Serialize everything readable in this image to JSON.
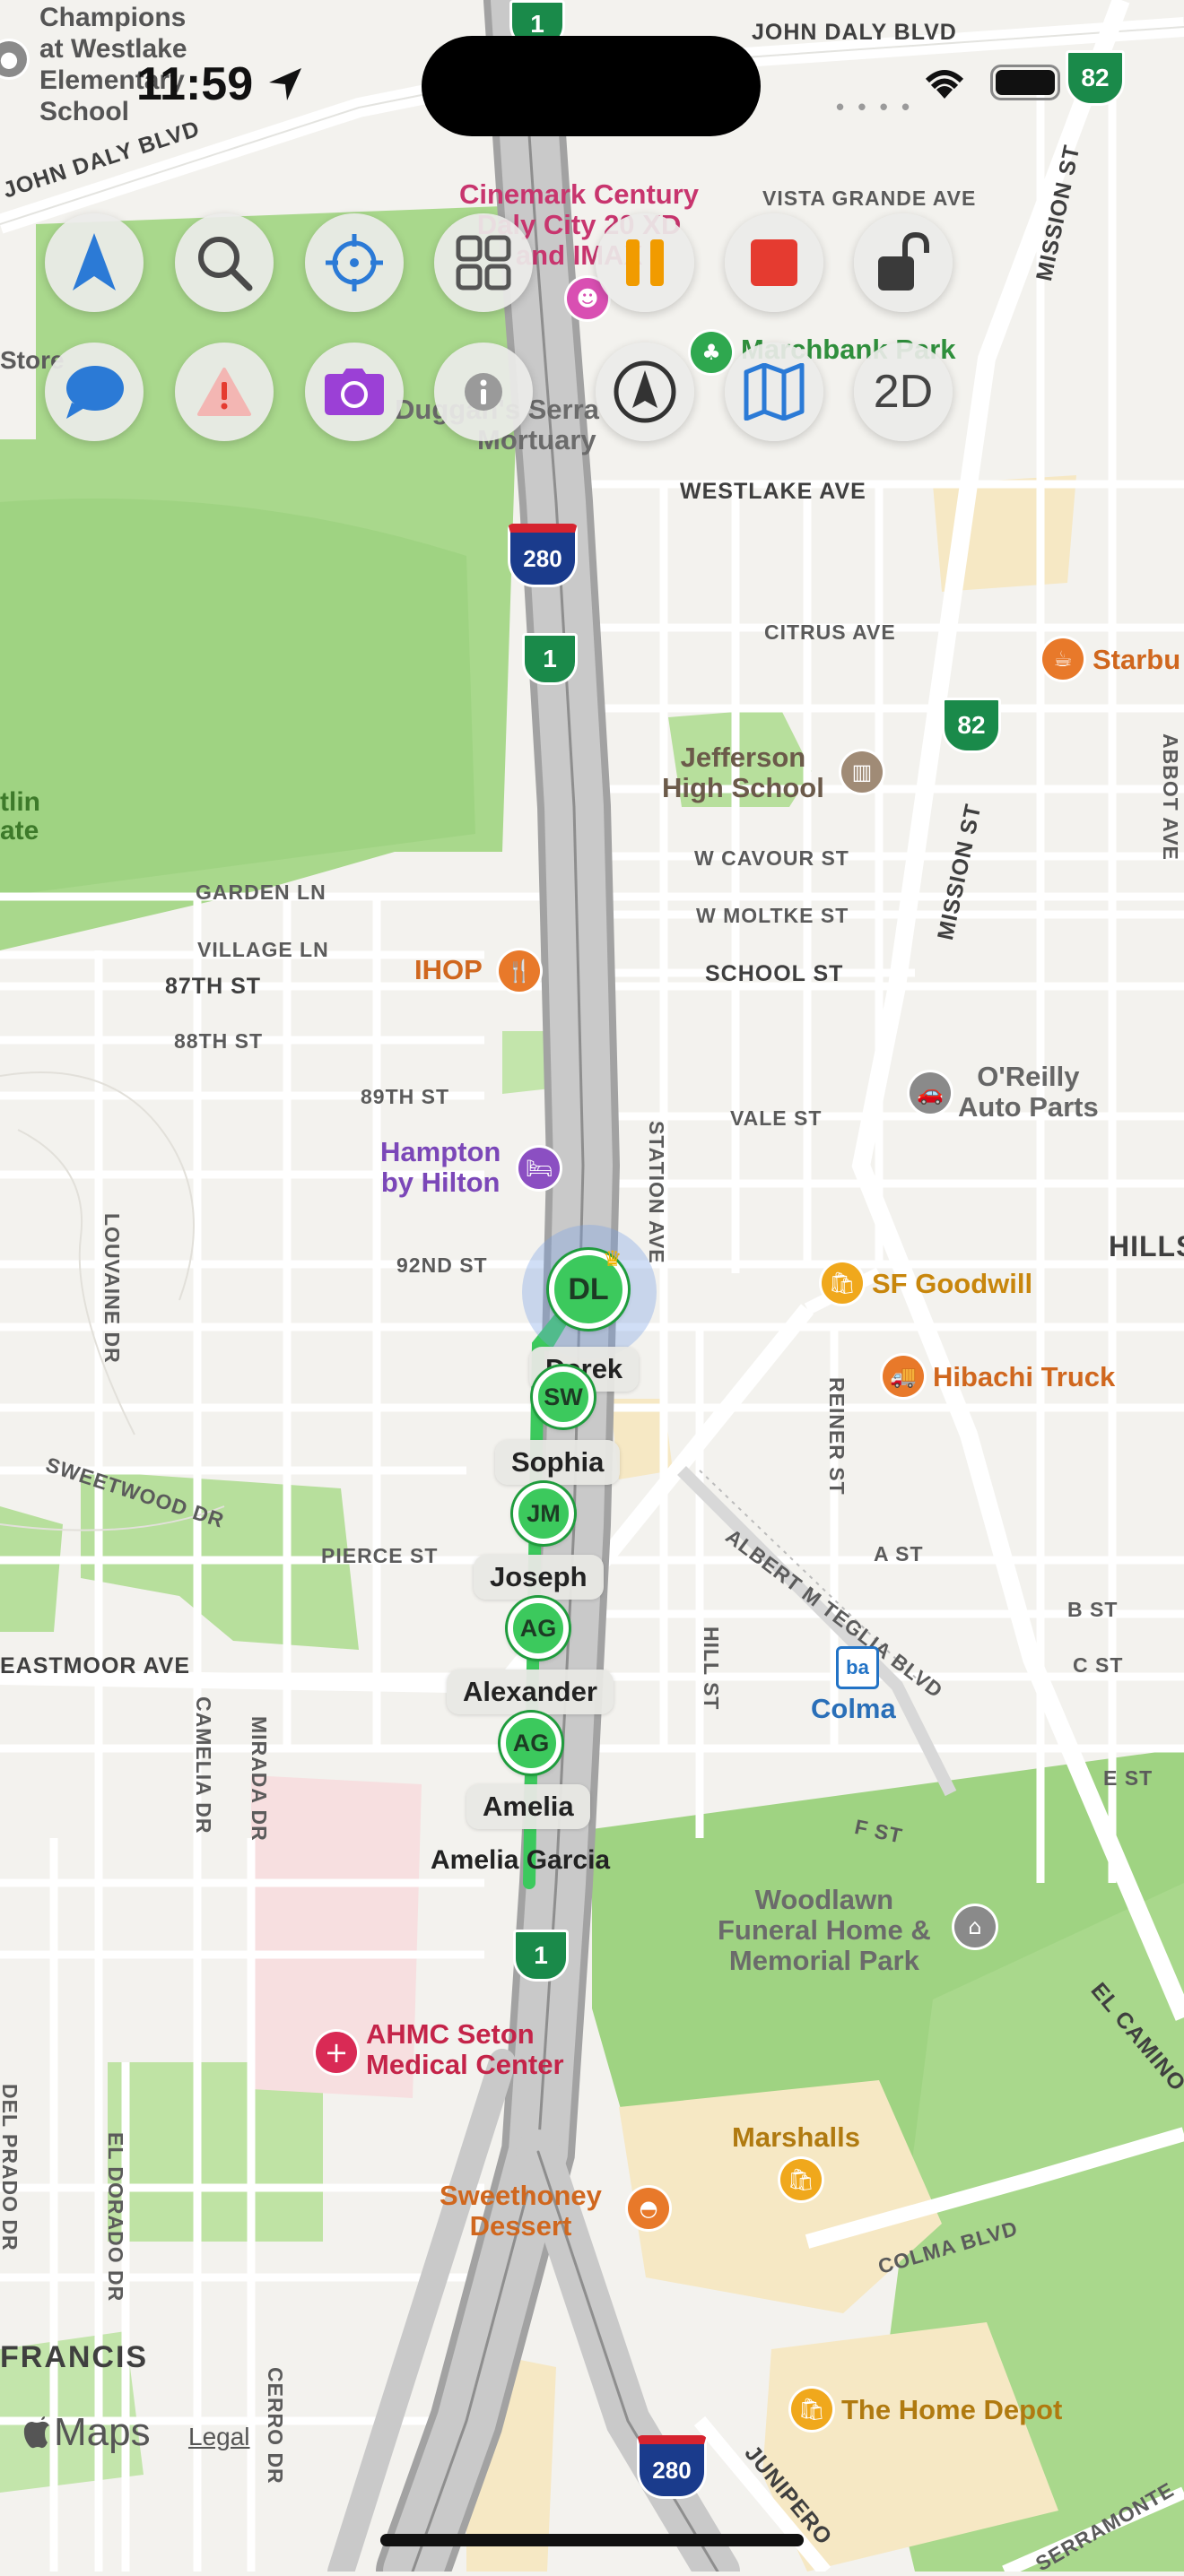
{
  "status_bar": {
    "time": "11:59"
  },
  "toolbar": {
    "row1": [
      {
        "name": "navigation-arrow-button",
        "icon": "navigation-arrow-icon"
      },
      {
        "name": "search-button",
        "icon": "magnifier-icon"
      },
      {
        "name": "locate-me-button",
        "icon": "crosshair-icon"
      },
      {
        "name": "grid-menu-button",
        "icon": "grid-icon"
      },
      {
        "name": "pause-button",
        "icon": "pause-icon"
      },
      {
        "name": "stop-button",
        "icon": "stop-icon"
      },
      {
        "name": "lock-button",
        "icon": "unlocked-padlock-icon"
      }
    ],
    "row2": [
      {
        "name": "messages-button",
        "icon": "chat-bubble-icon"
      },
      {
        "name": "alert-button",
        "icon": "warning-triangle-icon"
      },
      {
        "name": "camera-button",
        "icon": "camera-icon"
      },
      {
        "name": "info-button",
        "icon": "info-icon"
      },
      {
        "name": "compass-button",
        "icon": "compass-icon"
      },
      {
        "name": "map-style-button",
        "icon": "folded-map-icon"
      },
      {
        "name": "view-mode-button",
        "label": "2D"
      }
    ]
  },
  "map": {
    "streets": {
      "john_daly_left": "JOHN DALY BLVD",
      "john_daly_right": "JOHN DALY BLVD",
      "vista_grande": "VISTA GRANDE AVE",
      "westlake": "WESTLAKE AVE",
      "citrus": "CITRUS AVE",
      "w_cavour": "W CAVOUR ST",
      "w_moltke": "W MOLTKE ST",
      "school": "SCHOOL ST",
      "vale": "VALE ST",
      "garden": "GARDEN LN",
      "village": "VILLAGE LN",
      "st87": "87TH ST",
      "st88": "88TH ST",
      "st89": "89TH ST",
      "st92": "92ND ST",
      "station": "STATION AVE",
      "mission1": "MISSION ST",
      "mission2": "MISSION ST",
      "louvaine": "LOUVAINE DR",
      "sweetwood": "SWEETWOOD DR",
      "pierce": "PIERCE ST",
      "eastmoor": "EASTMOOR AVE",
      "camelia": "CAMELIA DR",
      "mirada": "MIRADA DR",
      "hill": "HILL ST",
      "reiner": "REINER ST",
      "albert": "ALBERT M TEGLIA BLVD",
      "a_st": "A ST",
      "b_st": "B ST",
      "c_st": "C ST",
      "e_st": "E ST",
      "f_st": "F ST",
      "colma_blvd": "COLMA BLVD",
      "el_dorado": "EL DORADO DR",
      "del_prado": "DEL PRADO DR",
      "cerro": "CERRO DR",
      "el_camino": "EL CAMINO",
      "junipero": "JUNIPERO",
      "serramonte": "SERRAMONTE",
      "abbot": "ABBOT AVE",
      "francis": "FRANCIS",
      "store": "Store",
      "hills": "HILLS",
      "olin_a": "tlin",
      "olin_b": "ate"
    },
    "pois": {
      "champions": [
        "Champions",
        "at Westlake",
        "Elementary",
        "School"
      ],
      "cinemark": [
        "Cinemark Century",
        "Daly City 20 XD",
        "and IMAX"
      ],
      "marchbank": "Marchbank Park",
      "duggans": [
        "Duggan's Serra",
        "Mortuary"
      ],
      "starbucks": "Starbu",
      "jefferson": [
        "Jefferson",
        "High School"
      ],
      "ihop": "IHOP",
      "oreilly": [
        "O'Reilly",
        "Auto Parts"
      ],
      "hampton": [
        "Hampton",
        "by Hilton"
      ],
      "goodwill": "SF Goodwill",
      "hibachi": "Hibachi Truck",
      "colma": "Colma",
      "woodlawn": [
        "Woodlawn",
        "Funeral Home &",
        "Memorial Park"
      ],
      "ahmc": [
        "AHMC Seton",
        "Medical Center"
      ],
      "marshalls": "Marshalls",
      "sweethoney": [
        "Sweethoney",
        "Dessert"
      ],
      "home_depot": "The Home Depot"
    },
    "shields": {
      "hw1_top": "1",
      "hw82_top": "82",
      "i280_top": "280",
      "hw1_mid": "1",
      "hw82_mid": "82",
      "hw1_bottom": "1",
      "i280_bottom": "280"
    },
    "attribution": {
      "brand": "Maps",
      "legal": "Legal"
    }
  },
  "people": [
    {
      "initials": "DL",
      "name": "Derek",
      "leader": true
    },
    {
      "initials": "SW",
      "name": "Sophia"
    },
    {
      "initials": "JM",
      "name": "Joseph"
    },
    {
      "initials": "AG",
      "name": "Alexander"
    },
    {
      "initials": "AG",
      "name": "Amelia"
    }
  ],
  "selected_person_full_name": "Amelia Garcia",
  "colors": {
    "accent_blue": "#2b7ad6",
    "pause_orange": "#f19b00",
    "stop_red": "#e53b30",
    "camera_purple": "#9b40d6",
    "marker_green": "#3cc95d",
    "poi_orange": "#e8792a",
    "poi_purple": "#8b4fc2",
    "poi_red": "#d92a55"
  }
}
